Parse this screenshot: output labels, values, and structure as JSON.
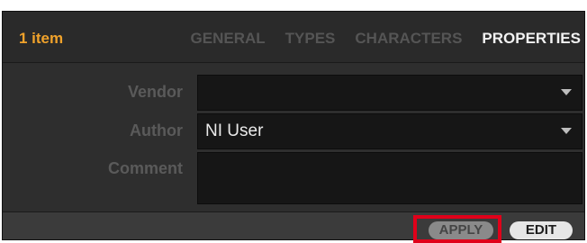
{
  "header": {
    "count_label": "1 item",
    "tabs": [
      {
        "label": "GENERAL",
        "active": false
      },
      {
        "label": "TYPES",
        "active": false
      },
      {
        "label": "CHARACTERS",
        "active": false
      },
      {
        "label": "PROPERTIES",
        "active": true
      }
    ]
  },
  "properties": {
    "vendor": {
      "label": "Vendor",
      "value": ""
    },
    "author": {
      "label": "Author",
      "value": "NI User"
    },
    "comment": {
      "label": "Comment",
      "value": ""
    }
  },
  "footer": {
    "apply_label": "APPLY",
    "edit_label": "EDIT"
  },
  "colors": {
    "accent": "#f0a22b",
    "highlight": "#e0001a"
  }
}
